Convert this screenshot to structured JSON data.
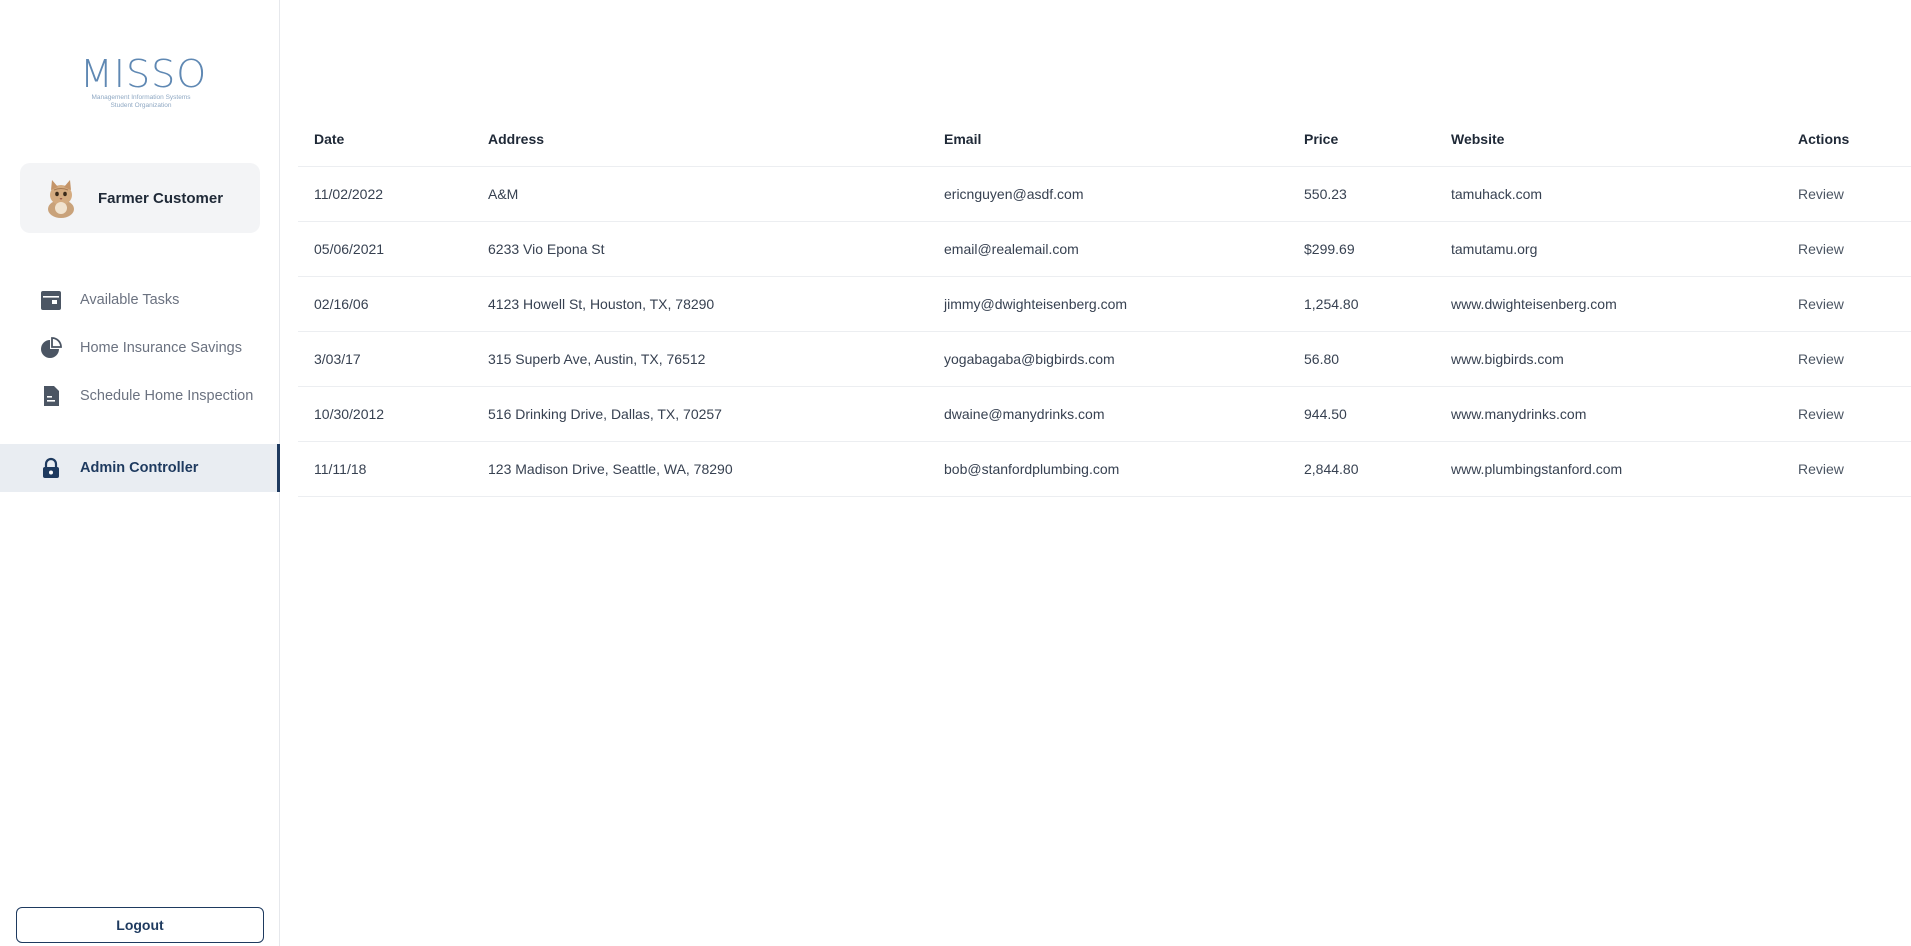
{
  "sidebar": {
    "logo": {
      "word": "MISSO",
      "line1": "Management Information Systems",
      "line2": "Student Organization"
    },
    "user": {
      "name": "Farmer Customer",
      "avatar_icon": "cat-avatar"
    },
    "nav": [
      {
        "label": "Available Tasks",
        "icon": "calendar-icon"
      },
      {
        "label": "Home Insurance Savings",
        "icon": "pie-chart-icon"
      },
      {
        "label": "Schedule Home Inspection",
        "icon": "document-icon"
      }
    ],
    "active_nav": {
      "label": "Admin Controller",
      "icon": "lock-icon"
    },
    "logout_label": "Logout"
  },
  "table": {
    "headers": [
      "Date",
      "Address",
      "Email",
      "Price",
      "Website",
      "Actions"
    ],
    "rows": [
      {
        "date": "11/02/2022",
        "address": "A&M",
        "email": "ericnguyen@asdf.com",
        "price": "550.23",
        "website": "tamuhack.com",
        "action": "Review"
      },
      {
        "date": "05/06/2021",
        "address": "6233 Vio Epona St",
        "email": "email@realemail.com",
        "price": "$299.69",
        "website": "tamutamu.org",
        "action": "Review"
      },
      {
        "date": "02/16/06",
        "address": "4123 Howell St, Houston, TX, 78290",
        "email": "jimmy@dwighteisenberg.com",
        "price": "1,254.80",
        "website": "www.dwighteisenberg.com",
        "action": "Review"
      },
      {
        "date": "3/03/17",
        "address": "315 Superb Ave, Austin, TX, 76512",
        "email": "yogabagaba@bigbirds.com",
        "price": "56.80",
        "website": "www.bigbirds.com",
        "action": "Review"
      },
      {
        "date": "10/30/2012",
        "address": "516 Drinking Drive, Dallas, TX, 70257",
        "email": "dwaine@manydrinks.com",
        "price": "944.50",
        "website": "www.manydrinks.com",
        "action": "Review"
      },
      {
        "date": "11/11/18",
        "address": "123 Madison Drive, Seattle, WA, 78290",
        "email": "bob@stanfordplumbing.com",
        "price": "2,844.80",
        "website": "www.plumbingstanford.com",
        "action": "Review"
      }
    ]
  },
  "colors": {
    "accent": "#1e3a5f",
    "active_bg": "#e9edf2",
    "muted_text": "#6b7280",
    "logo": "#5f88b3"
  }
}
